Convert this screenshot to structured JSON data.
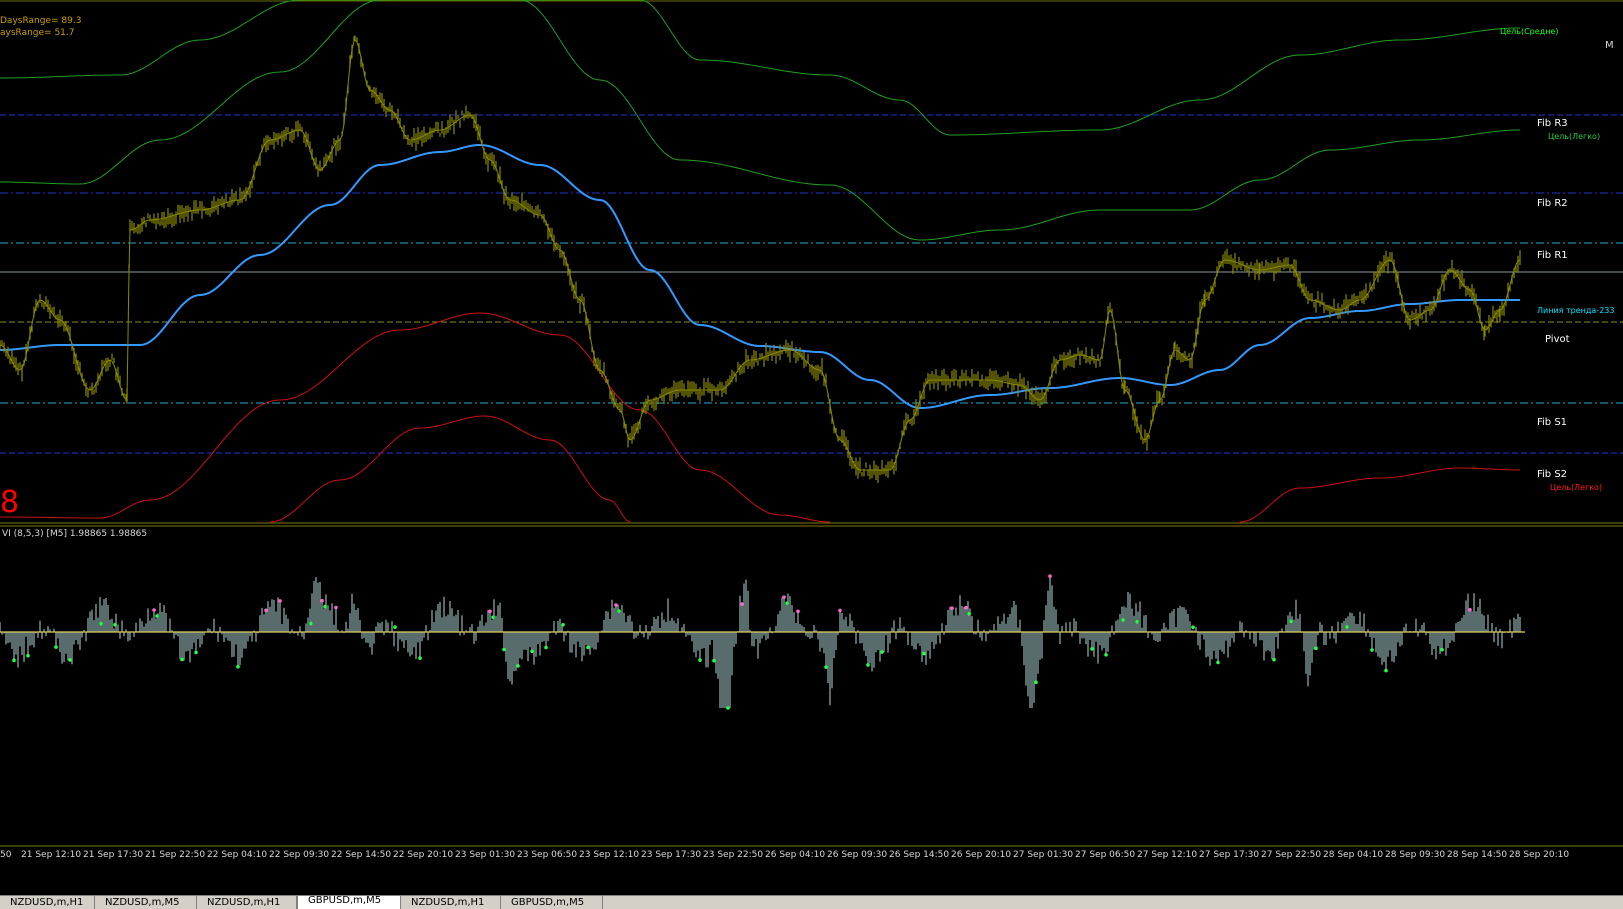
{
  "info": {
    "line1": "DaysRange= 89.3",
    "line2": "aysRange= 51.7"
  },
  "levels": [
    {
      "id": "fib-r3",
      "label": "Fib R3",
      "price": 1.9945
    },
    {
      "id": "fib-r2",
      "label": "Fib R2",
      "price": 1.9915
    },
    {
      "id": "fib-r1",
      "label": "Fib R1",
      "price": 1.9896
    },
    {
      "id": "pivot",
      "label": "Pivot",
      "price": 1.9865
    },
    {
      "id": "fib-s1",
      "label": "Fib S1",
      "price": 1.9834
    },
    {
      "id": "fib-s2",
      "label": "Fib S2",
      "price": 1.9815
    }
  ],
  "targets": {
    "mid_up": "Цель(Средне)",
    "easy_up": "Цель(Легко)",
    "trend": "Линия тренда-233",
    "easy_down": "Цель(Легко)"
  },
  "big_red_text": "8",
  "right_edge_text": "M",
  "indicator": {
    "title": "VI (8,5,3) [M5] 1.98865 1.98865"
  },
  "time_axis": [
    "50",
    "21 Sep 12:10",
    "21 Sep 17:30",
    "21 Sep 22:50",
    "22 Sep 04:10",
    "22 Sep 09:30",
    "22 Sep 14:50",
    "22 Sep 20:10",
    "23 Sep 01:30",
    "23 Sep 06:50",
    "23 Sep 12:10",
    "23 Sep 17:30",
    "23 Sep 22:50",
    "26 Sep 04:10",
    "26 Sep 09:30",
    "26 Sep 14:50",
    "26 Sep 20:10",
    "27 Sep 01:30",
    "27 Sep 06:50",
    "27 Sep 12:10",
    "27 Sep 17:30",
    "27 Sep 22:50",
    "28 Sep 04:10",
    "28 Sep 09:30",
    "28 Sep 14:50",
    "28 Sep 20:10"
  ],
  "tabs": [
    {
      "label": "NZDUSD,m,H1",
      "active": false
    },
    {
      "label": "NZDUSD,m,M5",
      "active": false
    },
    {
      "label": "NZDUSD,m,H1",
      "active": false
    },
    {
      "label": "GBPUSD,m,M5",
      "active": true
    },
    {
      "label": "NZDUSD,m,H1",
      "active": false
    },
    {
      "label": "GBPUSD,m,M5",
      "active": false
    }
  ],
  "colors": {
    "background": "#000000",
    "price": "#8a8a00",
    "ma": "#3399ff",
    "band_green": "#1fa01f",
    "band_red": "#cc1111",
    "fib_blue": "#2233cc",
    "fib_cyan": "#22aacc",
    "pivot": "#8a8a20",
    "histogram": "#7f9a9a",
    "zero_line": "#e0d060"
  }
}
